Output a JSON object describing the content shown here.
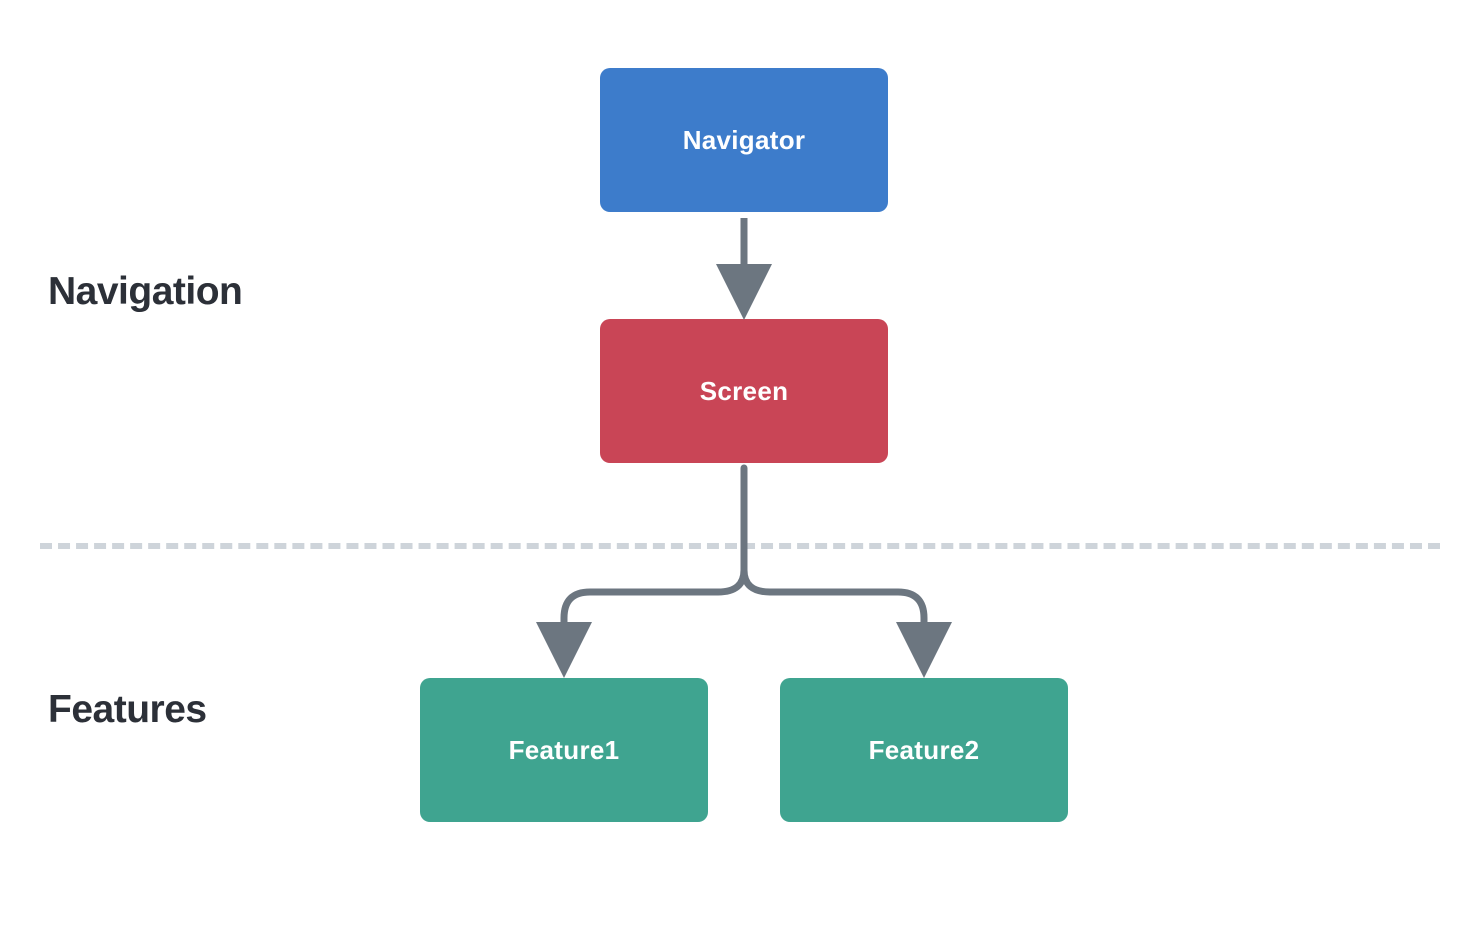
{
  "sections": {
    "navigation_label": "Navigation",
    "features_label": "Features"
  },
  "nodes": {
    "navigator": "Navigator",
    "screen": "Screen",
    "feature1": "Feature1",
    "feature2": "Feature2"
  },
  "colors": {
    "navigator": "#3d7ccb",
    "screen": "#c94556",
    "feature": "#3fa490",
    "label_text": "#2c3038",
    "arrow": "#6c7680",
    "divider": "#ced4da"
  },
  "layout": {
    "structure": "tree",
    "edges": [
      {
        "from": "navigator",
        "to": "screen"
      },
      {
        "from": "screen",
        "to": "feature1"
      },
      {
        "from": "screen",
        "to": "feature2"
      }
    ]
  }
}
